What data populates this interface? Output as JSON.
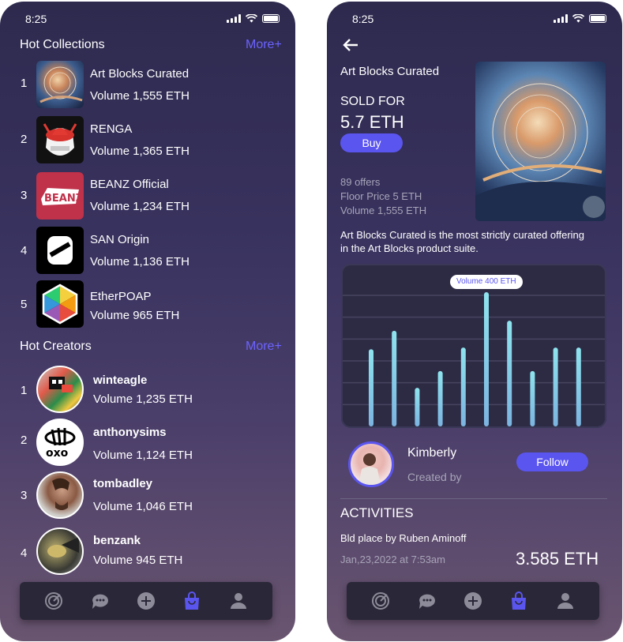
{
  "status": {
    "time": "8:25"
  },
  "left": {
    "collections_title": "Hot Collections",
    "more_label": "More+",
    "collections": [
      {
        "rank": "1",
        "name": "Art Blocks Curated",
        "volume": "Volume 1,555 ETH",
        "thumb_icon": "artwork-thumbnail"
      },
      {
        "rank": "2",
        "name": "RENGA",
        "volume": "Volume 1,365 ETH",
        "thumb_icon": "renga-character-thumbnail"
      },
      {
        "rank": "3",
        "name": "BEANZ Official",
        "volume": "Volume 1,234 ETH",
        "thumb_icon": "beanz-logo-thumbnail"
      },
      {
        "rank": "4",
        "name": "SAN Origin",
        "volume": "Volume 1,136 ETH",
        "thumb_icon": "san-logo-thumbnail"
      },
      {
        "rank": "5",
        "name": "EtherPOAP",
        "volume": "Volume 965 ETH",
        "thumb_icon": "hexagon-logo-thumbnail"
      }
    ],
    "creators_title": "Hot Creators",
    "creators": [
      {
        "rank": "1",
        "name": "winteagle",
        "volume": "Volume 1,235 ETH"
      },
      {
        "rank": "2",
        "name": "anthonysims",
        "volume": "Volume 1,124 ETH"
      },
      {
        "rank": "3",
        "name": "tombadley",
        "volume": "Volume 1,046 ETH"
      },
      {
        "rank": "4",
        "name": "benzank",
        "volume": "Volume 945 ETH"
      }
    ]
  },
  "nav": {
    "items": [
      "radar-icon",
      "chat-icon",
      "add-icon",
      "bag-icon",
      "profile-icon"
    ],
    "active": "bag-icon",
    "active_color": "#5b55f0"
  },
  "detail": {
    "title": "Art Blocks Curated",
    "sold_label": "SOLD FOR",
    "price": "5.7 ETH",
    "buy_label": "Buy",
    "offers": "89 offers",
    "floor": "Floor Price 5 ETH",
    "volume": "Volume 1,555 ETH",
    "description": "Art Blocks Curated is the most strictly curated offering in the Art Blocks product suite.",
    "creator_name": "Kimberly",
    "created_by": "Created by",
    "follow_label": "Follow",
    "activities_title": "ACTIVITIES",
    "activity_text": "Bld place by Ruben Aminoff",
    "activity_date": "Jan,23,2022 at 7:53am",
    "activity_amount": "3.585 ETH"
  },
  "chart_data": {
    "type": "bar",
    "tooltip": "Volume 400 ETH",
    "values": [
      230,
      285,
      115,
      165,
      235,
      400,
      315,
      165,
      235,
      235
    ],
    "ylim": [
      0,
      400
    ],
    "grid": true
  },
  "colors": {
    "accent": "#5b55f0",
    "more": "#6c63ff",
    "bar": "#8ee4ee"
  }
}
